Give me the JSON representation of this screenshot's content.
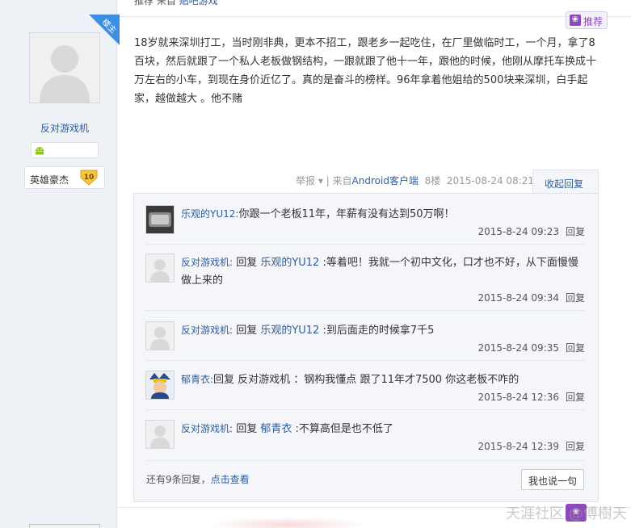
{
  "previous_line": {
    "text": "推荐 来自",
    "link": "贴吧游戏"
  },
  "author": {
    "badge": "楼主",
    "username": "反对游戏机",
    "title_label": "英雄豪杰",
    "level": "10"
  },
  "recommend_button": {
    "label": "推荐",
    "icon": "paw-icon"
  },
  "post": {
    "body": "18岁就来深圳打工，当时刚非典，更本不招工，跟老乡一起吃住，在厂里做临时工，一个月，拿了8百块，然后就跟了一个私人老板做钢结构，一跟就跟了他十一年，跟他的时候，他刚从摩托车换成十万左右的小车，到现在身价近亿了。真的是奋斗的榜样。96年拿着他姐给的500块来深圳，白手起家，越做越大 。他不赌",
    "report_label": "举报",
    "source_prefix": "| 来自",
    "source_link": "Android客户端",
    "floor": "8楼",
    "datetime": "2015-08-24 08:21",
    "collapse_label": "收起回复"
  },
  "replies": [
    {
      "name": "乐观的YU12:",
      "prefix": "",
      "ref": "",
      "text": "你跟一个老板11年，年薪有没有达到50万啊！",
      "time": "2015-8-24 09:23",
      "reply_label": "回复",
      "avatar": "photo-avatar"
    },
    {
      "name": "反对游戏机:",
      "prefix": "回复 ",
      "ref": "乐观的YU12",
      "text": " :等着吧！我就一个初中文化，口才也不好，从下面慢慢做上来的",
      "time": "2015-8-24 09:34",
      "reply_label": "回复",
      "avatar": "default-avatar"
    },
    {
      "name": "反对游戏机:",
      "prefix": "回复 ",
      "ref": "乐观的YU12",
      "text": " :到后面走的时候拿7千5",
      "time": "2015-8-24 09:35",
      "reply_label": "回复",
      "avatar": "default-avatar"
    },
    {
      "name": "郁青衣:",
      "prefix": "回复 反对游戏机 ：钢构我懂点 跟了11年才7500 你这老板不咋的",
      "ref": "",
      "text": "",
      "time": "2015-8-24 12:36",
      "reply_label": "回复",
      "avatar": "cartoon-avatar"
    },
    {
      "name": "反对游戏机:",
      "prefix": "回复 ",
      "ref": "郁青衣",
      "text": " :不算高但是也不低了",
      "time": "2015-8-24 12:39",
      "reply_label": "回复",
      "avatar": "default-avatar"
    }
  ],
  "more_replies": {
    "text": "还有9条回复，",
    "link": "点击查看"
  },
  "say_button": "我也说一句",
  "watermark": "天涯社区 @傅樹天",
  "colors": {
    "link": "#2f5d9a",
    "badge_blue": "#3d8ee3",
    "recommend_purple": "#8c4bb8"
  }
}
